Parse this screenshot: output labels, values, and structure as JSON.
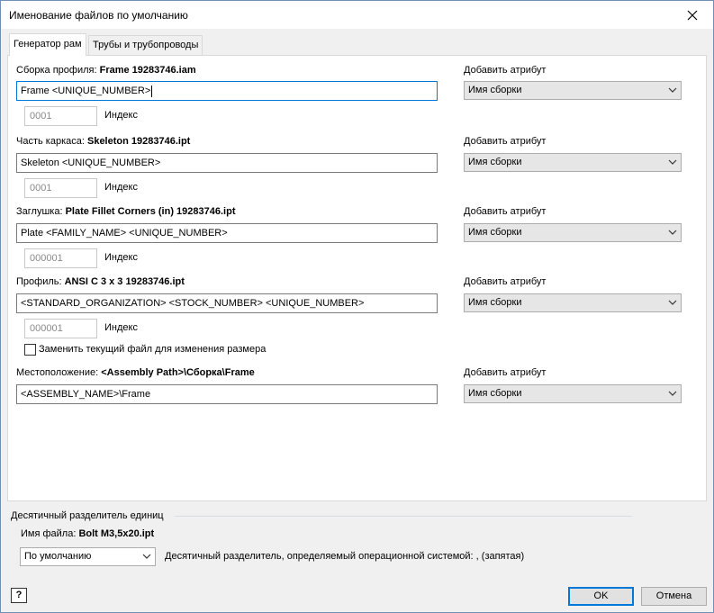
{
  "window": {
    "title": "Именование файлов по умолчанию",
    "close_glyph": "✕"
  },
  "tabs": [
    {
      "label": "Генератор рам",
      "active": true
    },
    {
      "label": "Трубы и трубопроводы",
      "active": false
    }
  ],
  "sections": [
    {
      "label_prefix": "Сборка профиля:",
      "label_value": "Frame 19283746.iam",
      "pattern": "Frame <UNIQUE_NUMBER>",
      "focused": true,
      "index": "0001",
      "index_label": "Индекс",
      "attr_label": "Добавить атрибут",
      "attr_value": "Имя сборки"
    },
    {
      "label_prefix": "Часть каркаса:",
      "label_value": "Skeleton 19283746.ipt",
      "pattern": "Skeleton <UNIQUE_NUMBER>",
      "focused": false,
      "index": "0001",
      "index_label": "Индекс",
      "attr_label": "Добавить атрибут",
      "attr_value": "Имя сборки"
    },
    {
      "label_prefix": "Заглушка:",
      "label_value": "Plate Fillet Corners (in) 19283746.ipt",
      "pattern": "Plate <FAMILY_NAME> <UNIQUE_NUMBER>",
      "focused": false,
      "index": "000001",
      "index_label": "Индекс",
      "attr_label": "Добавить атрибут",
      "attr_value": "Имя сборки"
    },
    {
      "label_prefix": "Профиль:",
      "label_value": "ANSI C 3 x 3 19283746.ipt",
      "pattern": "<STANDARD_ORGANIZATION> <STOCK_NUMBER> <UNIQUE_NUMBER>",
      "focused": false,
      "index": "000001",
      "index_label": "Индекс",
      "attr_label": "Добавить атрибут",
      "attr_value": "Имя сборки"
    }
  ],
  "replace_checkbox": {
    "label": "Заменить текущий файл для изменения размера",
    "checked": false
  },
  "location": {
    "label_prefix": "Местоположение:",
    "label_value": "<Assembly Path>\\Сборка\\Frame",
    "pattern": "<ASSEMBLY_NAME>\\Frame",
    "attr_label": "Добавить атрибут",
    "attr_value": "Имя сборки"
  },
  "decimal_group": {
    "title": "Десятичный разделитель единиц",
    "filename_prefix": "Имя файла:",
    "filename_value": "Bolt M3,5x20.ipt",
    "select_value": "По умолчанию",
    "description": "Десятичный разделитель, определяемый операционной системой: , (запятая)"
  },
  "footer": {
    "help_glyph": "?",
    "ok_label": "OK",
    "cancel_label": "Отмена"
  },
  "colors": {
    "accent": "#0078d7",
    "panel_bg": "#ffffff",
    "dialog_bg": "#f0f0f0"
  },
  "icons": {
    "close": "close-icon",
    "dropdown": "chevron-down-icon",
    "help": "help-icon"
  }
}
